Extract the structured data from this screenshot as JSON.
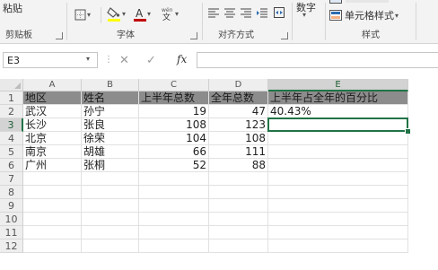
{
  "ribbon": {
    "clipboard": {
      "paste_label": "粘贴",
      "group_label": "剪贴板"
    },
    "font": {
      "group_label": "字体",
      "fill_color": "#ffff00",
      "font_color": "#c00000"
    },
    "alignment": {
      "group_label": "对齐方式"
    },
    "number": {
      "label": "数字"
    },
    "styles": {
      "cell_styles_label": "单元格样式",
      "group_label": "样式"
    }
  },
  "formula_bar": {
    "name_box": "E3",
    "fx_label": "fx",
    "formula": ""
  },
  "grid": {
    "columns": [
      "A",
      "B",
      "C",
      "D",
      "E"
    ],
    "rows": [
      "1",
      "2",
      "3",
      "4",
      "5",
      "6",
      "7",
      "8",
      "9",
      "10",
      "11",
      "12"
    ],
    "selected_column": "E",
    "selected_row": "3",
    "header_row": [
      "地区",
      "姓名",
      "上半年总数",
      "全年总数",
      "上半年占全年的百分比"
    ],
    "data_rows": [
      [
        "武汉",
        "孙宁",
        "19",
        "47",
        "40.43%"
      ],
      [
        "长沙",
        "张良",
        "108",
        "123",
        ""
      ],
      [
        "北京",
        "徐荣",
        "104",
        "108",
        ""
      ],
      [
        "南京",
        "胡雄",
        "66",
        "111",
        ""
      ],
      [
        "广州",
        "张桐",
        "52",
        "88",
        ""
      ]
    ]
  },
  "colors": {
    "accent": "#217346",
    "header_fill": "#8c8c8c"
  }
}
